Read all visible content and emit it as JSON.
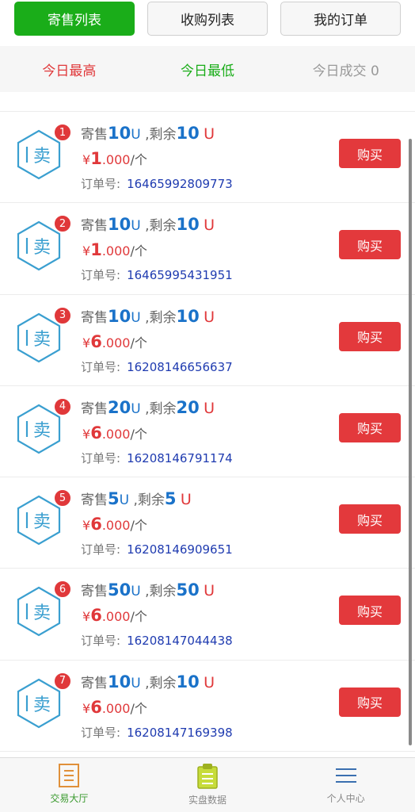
{
  "tabs": {
    "sell_list": "寄售列表",
    "buy_list": "收购列表",
    "my_orders": "我的订单"
  },
  "stats": {
    "high_label": "今日最高",
    "low_label": "今日最低",
    "deals_label": "今日成交 0"
  },
  "labels": {
    "sell_icon": "卖",
    "sell_prefix": "寄售",
    "remain_prefix": " ,剩余",
    "unit": "U",
    "currency": "¥",
    "per": "/个",
    "order_no": "订单号:",
    "buy": "购买"
  },
  "orders": [
    {
      "rank": "1",
      "amount": "10",
      "remain": "10",
      "price_int": "1",
      "price_dec": ".000",
      "order_id": "16465992809773"
    },
    {
      "rank": "2",
      "amount": "10",
      "remain": "10",
      "price_int": "1",
      "price_dec": ".000",
      "order_id": "16465995431951"
    },
    {
      "rank": "3",
      "amount": "10",
      "remain": "10",
      "price_int": "6",
      "price_dec": ".000",
      "order_id": "16208146656637"
    },
    {
      "rank": "4",
      "amount": "20",
      "remain": "20",
      "price_int": "6",
      "price_dec": ".000",
      "order_id": "16208146791174"
    },
    {
      "rank": "5",
      "amount": "5",
      "remain": "5",
      "price_int": "6",
      "price_dec": ".000",
      "order_id": "16208146909651"
    },
    {
      "rank": "6",
      "amount": "50",
      "remain": "50",
      "price_int": "6",
      "price_dec": ".000",
      "order_id": "16208147044438"
    },
    {
      "rank": "7",
      "amount": "10",
      "remain": "10",
      "price_int": "6",
      "price_dec": ".000",
      "order_id": "16208147169398"
    }
  ],
  "nav": {
    "trade_hall": "交易大厅",
    "market_data": "实盘数据",
    "personal_center": "个人中心"
  },
  "colors": {
    "brand_green": "#1aad19",
    "accent_red": "#e3393c",
    "amount_blue": "#1a72c9",
    "order_id_blue": "#1f3bb0",
    "hex_outline": "#3a9fd0"
  },
  "icons": {
    "sell_badge": "hexagon-sell-icon",
    "trade_hall": "document-list-icon",
    "market_data": "clipboard-icon",
    "personal_center": "hamburger-menu-icon"
  }
}
